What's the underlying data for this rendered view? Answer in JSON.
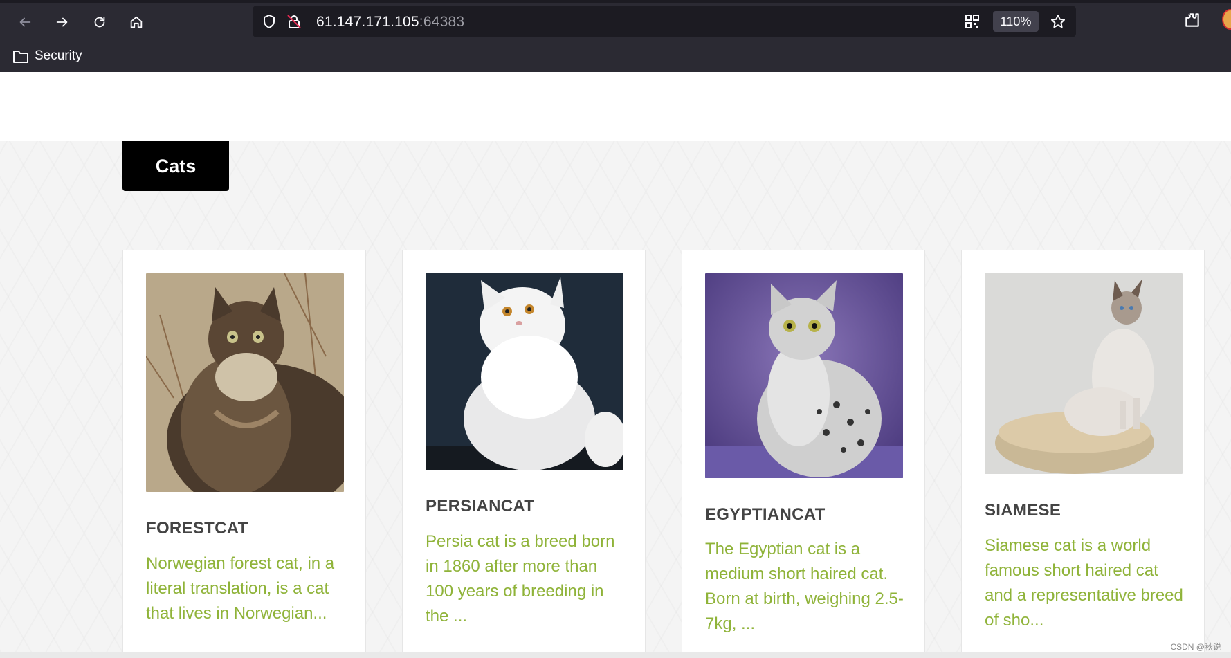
{
  "browser": {
    "url_host": "61.147.171.105",
    "url_port": ":64383",
    "zoom": "110%",
    "bookmark_label": "Security"
  },
  "page": {
    "nav_tab": "Cats",
    "cards": [
      {
        "title": "FORESTCAT",
        "description": "Norwegian forest cat, in a literal translation, is a cat that lives in Norwegian..."
      },
      {
        "title": "PERSIANCAT",
        "description": "Persia cat is a breed born in 1860 after more than 100 years of breeding in the ..."
      },
      {
        "title": "EGYPTIANCAT",
        "description": "The Egyptian cat is a medium short haired cat. Born at birth, weighing 2.5-7kg, ..."
      },
      {
        "title": "SIAMESE",
        "description": "Siamese cat is a world famous short haired cat and a representative breed of sho..."
      }
    ]
  },
  "watermark": "CSDN @秋说",
  "colors": {
    "accent": "#8fb339",
    "chrome": "#2b2a33",
    "urlbar": "#1c1b22"
  }
}
